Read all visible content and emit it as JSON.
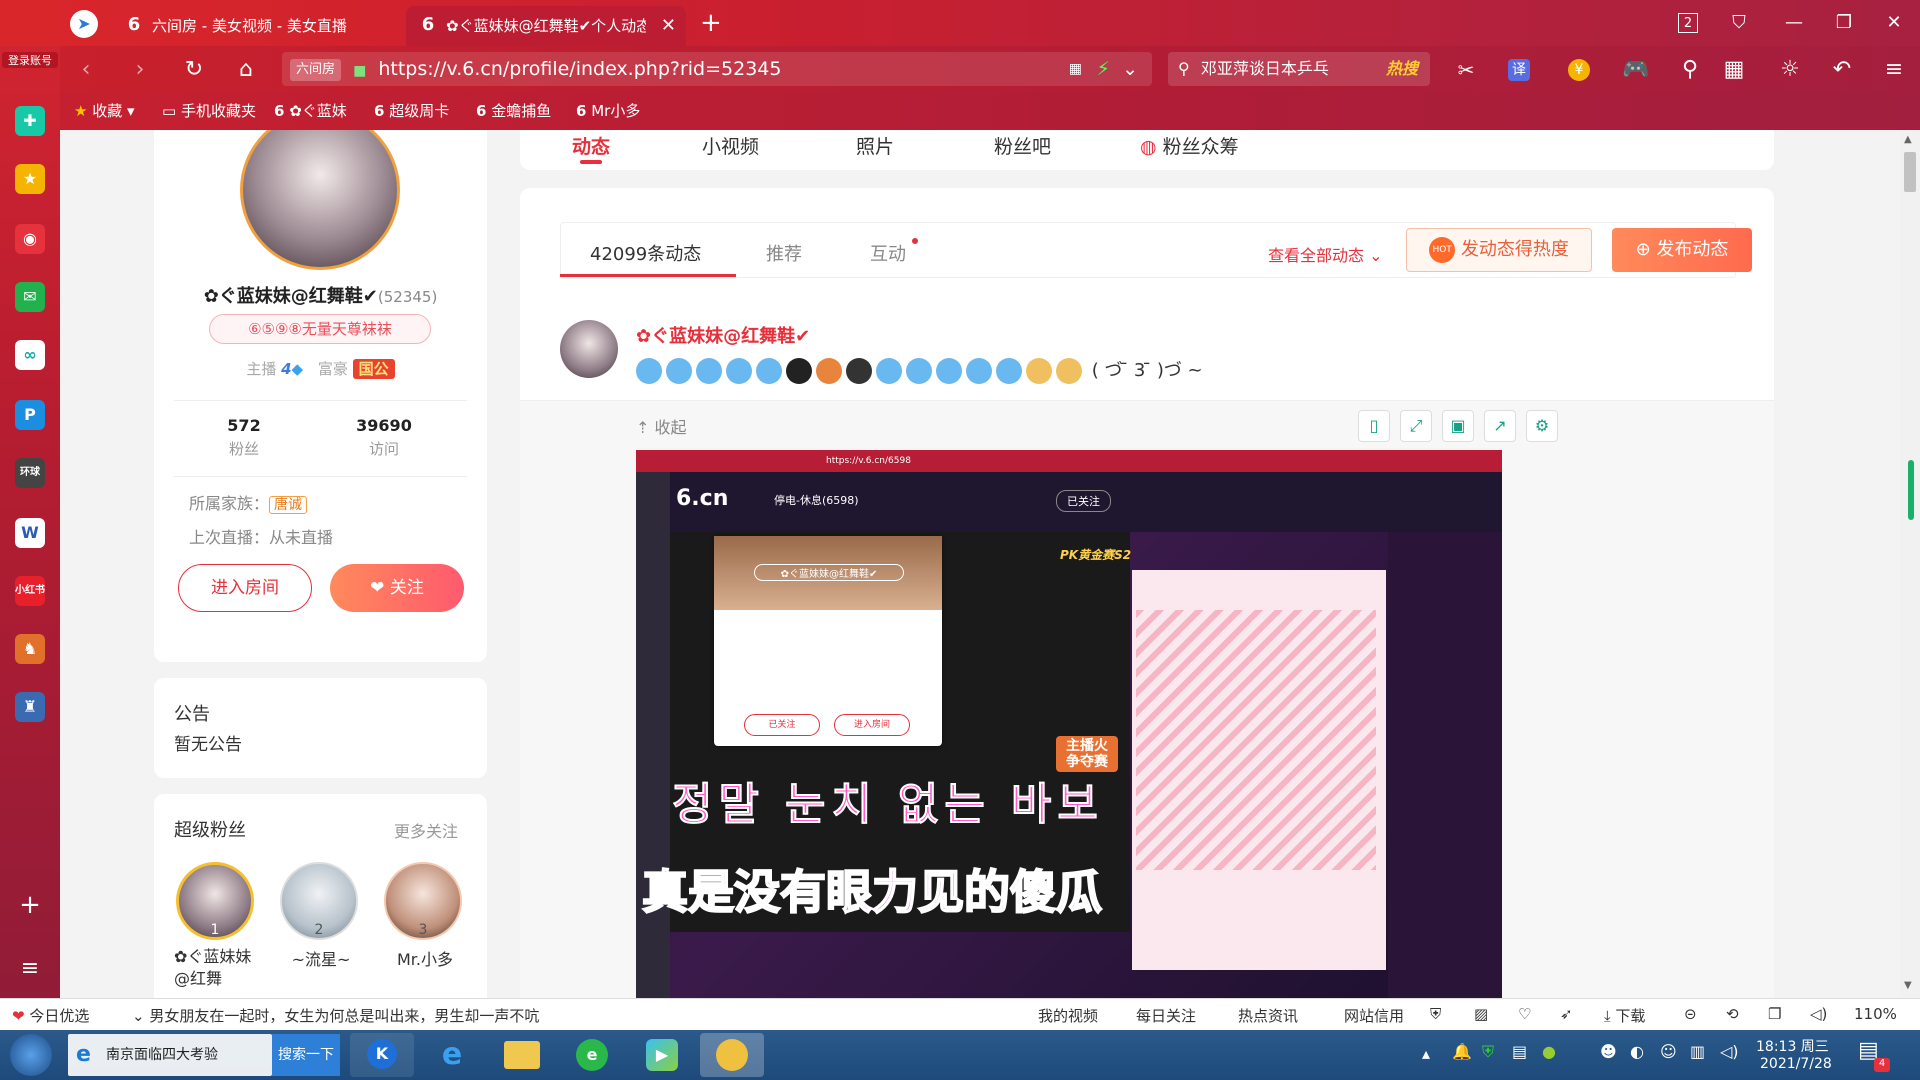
{
  "browser": {
    "sidebar_logo_label": "登录账号",
    "tabs": [
      {
        "label": "六间房 - 美女视频 - 美女直播",
        "active": false
      },
      {
        "label": "✿ぐ蓝妹妹@红舞鞋✔个人动态",
        "active": true
      }
    ],
    "new_tab_label": "+",
    "window_count": "2",
    "url_site_badge": "六间房",
    "url": "https://v.6.cn/profile/index.php?rid=52345",
    "search_text": "邓亚萍谈日本乒乓",
    "search_hot_label": "热搜",
    "bookmarks": [
      {
        "label": "收藏"
      },
      {
        "label": "手机收藏夹"
      },
      {
        "label": "✿ぐ蓝妹"
      },
      {
        "label": "超级周卡"
      },
      {
        "label": "金蟾捕鱼"
      },
      {
        "label": "Mr小多"
      }
    ]
  },
  "profile": {
    "name": "✿ぐ蓝妹妹@红舞鞋✔",
    "rid": "(52345)",
    "signature": "⑥⑤⑨⑧无量天尊袜袜",
    "anchor_label": "主播",
    "anchor_level": "4",
    "rich_label": "富豪",
    "rich_badge": "国公",
    "fans_count": "572",
    "fans_label": "粉丝",
    "visits_count": "39690",
    "visits_label": "访问",
    "family_label": "所属家族：",
    "family_badge": "唐诚",
    "last_live": "上次直播：从未直播",
    "enter_room": "进入房间",
    "follow": "关注"
  },
  "announcement": {
    "title": "公告",
    "text": "暂无公告"
  },
  "super_fans": {
    "title": "超级粉丝",
    "more": "更多关注",
    "fans": [
      {
        "rank": "1",
        "name": "✿ぐ蓝妹妹@红舞"
      },
      {
        "rank": "2",
        "name": "~流星~"
      },
      {
        "rank": "3",
        "name": "Mr.小多"
      }
    ]
  },
  "top_nav": [
    "动态",
    "小视频",
    "照片",
    "粉丝吧",
    "粉丝众筹"
  ],
  "feed": {
    "tabs": [
      "42099条动态",
      "推荐",
      "互动"
    ],
    "view_all": "查看全部动态",
    "boost_button": "发动态得热度",
    "publish_button": "发布动态",
    "post_author": "✿ぐ蓝妹妹@红舞鞋✔",
    "post_text_tail": "( づ ̄ 3 ̄ )づ ~",
    "collapse": "收起"
  },
  "embedded": {
    "url": "https://v.6.cn/6598",
    "host_name": "停电-休息(6598)",
    "follow_state": "已关注",
    "popup_name": "✿ぐ蓝妹妹@红舞鞋✔",
    "popup_followed": "已关注",
    "popup_enter": "进入房间",
    "pk_label": "PK黄金赛S2",
    "event_label": "主播火 争夺赛",
    "korean_caption": "정말 눈치 없는 바보",
    "chinese_caption": "真是没有眼力见的傻瓜"
  },
  "statusbar": {
    "left_label": "今日优选",
    "news": "男女朋友在一起时，女生为何总是叫出来，男生却一声不吭",
    "items": [
      "我的视频",
      "每日关注",
      "热点资讯",
      "网站信用",
      "下载"
    ],
    "zoom": "110%"
  },
  "taskbar": {
    "ie_label": "南京面临四大考验",
    "search_label": "搜索一下",
    "time": "18:13 周三",
    "date": "2021/7/28",
    "notif_count": "4"
  },
  "colors": {
    "accent_red": "#e8303c",
    "orange": "#ff7a45",
    "follow_gradient_start": "#ff8a5b",
    "follow_gradient_end": "#ff5a6e"
  }
}
